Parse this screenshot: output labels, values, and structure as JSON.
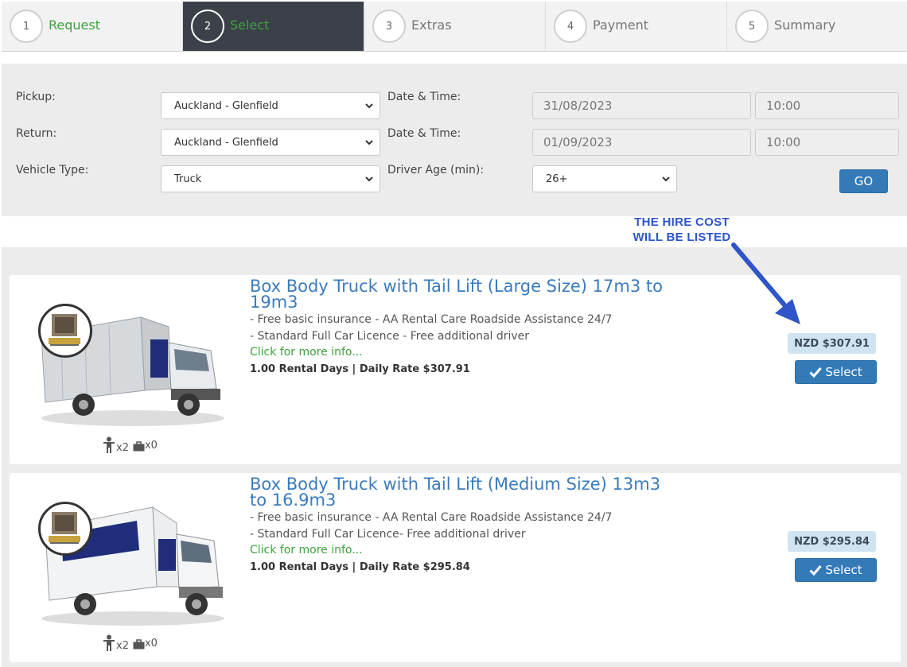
{
  "steps": [
    {
      "num": "1",
      "label": "Request"
    },
    {
      "num": "2",
      "label": "Select"
    },
    {
      "num": "3",
      "label": "Extras"
    },
    {
      "num": "4",
      "label": "Payment"
    },
    {
      "num": "5",
      "label": "Summary"
    }
  ],
  "search": {
    "pickup_label": "Pickup:",
    "pickup_value": "Auckland - Glenfield",
    "return_label": "Return:",
    "return_value": "Auckland - Glenfield",
    "vehicle_label": "Vehicle Type:",
    "vehicle_value": "Truck",
    "pickup_dt_label": "Date & Time:",
    "pickup_date": "31/08/2023",
    "pickup_time": "10:00",
    "return_dt_label": "Date & Time:",
    "return_date": "01/09/2023",
    "return_time": "10:00",
    "age_label": "Driver Age (min):",
    "age_value": "26+",
    "go_label": "GO"
  },
  "annotation": {
    "line1": "THE HIRE COST",
    "line2": "WILL BE LISTED"
  },
  "vehicles": [
    {
      "title": "Box Body Truck with Tail Lift (Large Size) 17m3 to 19m3",
      "feature1": "- Free basic insurance - AA Rental Care Roadside Assistance 24/7",
      "feature2": "- Standard Full Car Licence - Free additional driver",
      "more_info": "Click for more info...",
      "rate": "1.00 Rental Days | Daily Rate $307.91",
      "price": "NZD $307.91",
      "select_label": "Select",
      "passengers": "x2",
      "bags": "x0"
    },
    {
      "title": "Box Body Truck with Tail Lift (Medium Size) 13m3 to 16.9m3",
      "feature1": "- Free basic insurance - AA Rental Care Roadside Assistance 24/7",
      "feature2": "- Standard Full Car Licence- Free additional driver",
      "more_info": "Click for more info...",
      "rate": "1.00 Rental Days | Daily Rate $295.84",
      "price": "NZD $295.84",
      "select_label": "Select",
      "passengers": "x2",
      "bags": "x0"
    }
  ],
  "colors": {
    "accent": "#337ab7",
    "active_step": "#3c4149",
    "success_text": "#3aa43a",
    "title_blue": "#3a7bbf",
    "price_bg": "#cfe3f1",
    "annotation": "#2f55c8"
  },
  "icons": [
    "chevron-down-icon",
    "check-icon",
    "person-icon",
    "briefcase-icon",
    "arrow-icon",
    "tail-lift-icon"
  ]
}
